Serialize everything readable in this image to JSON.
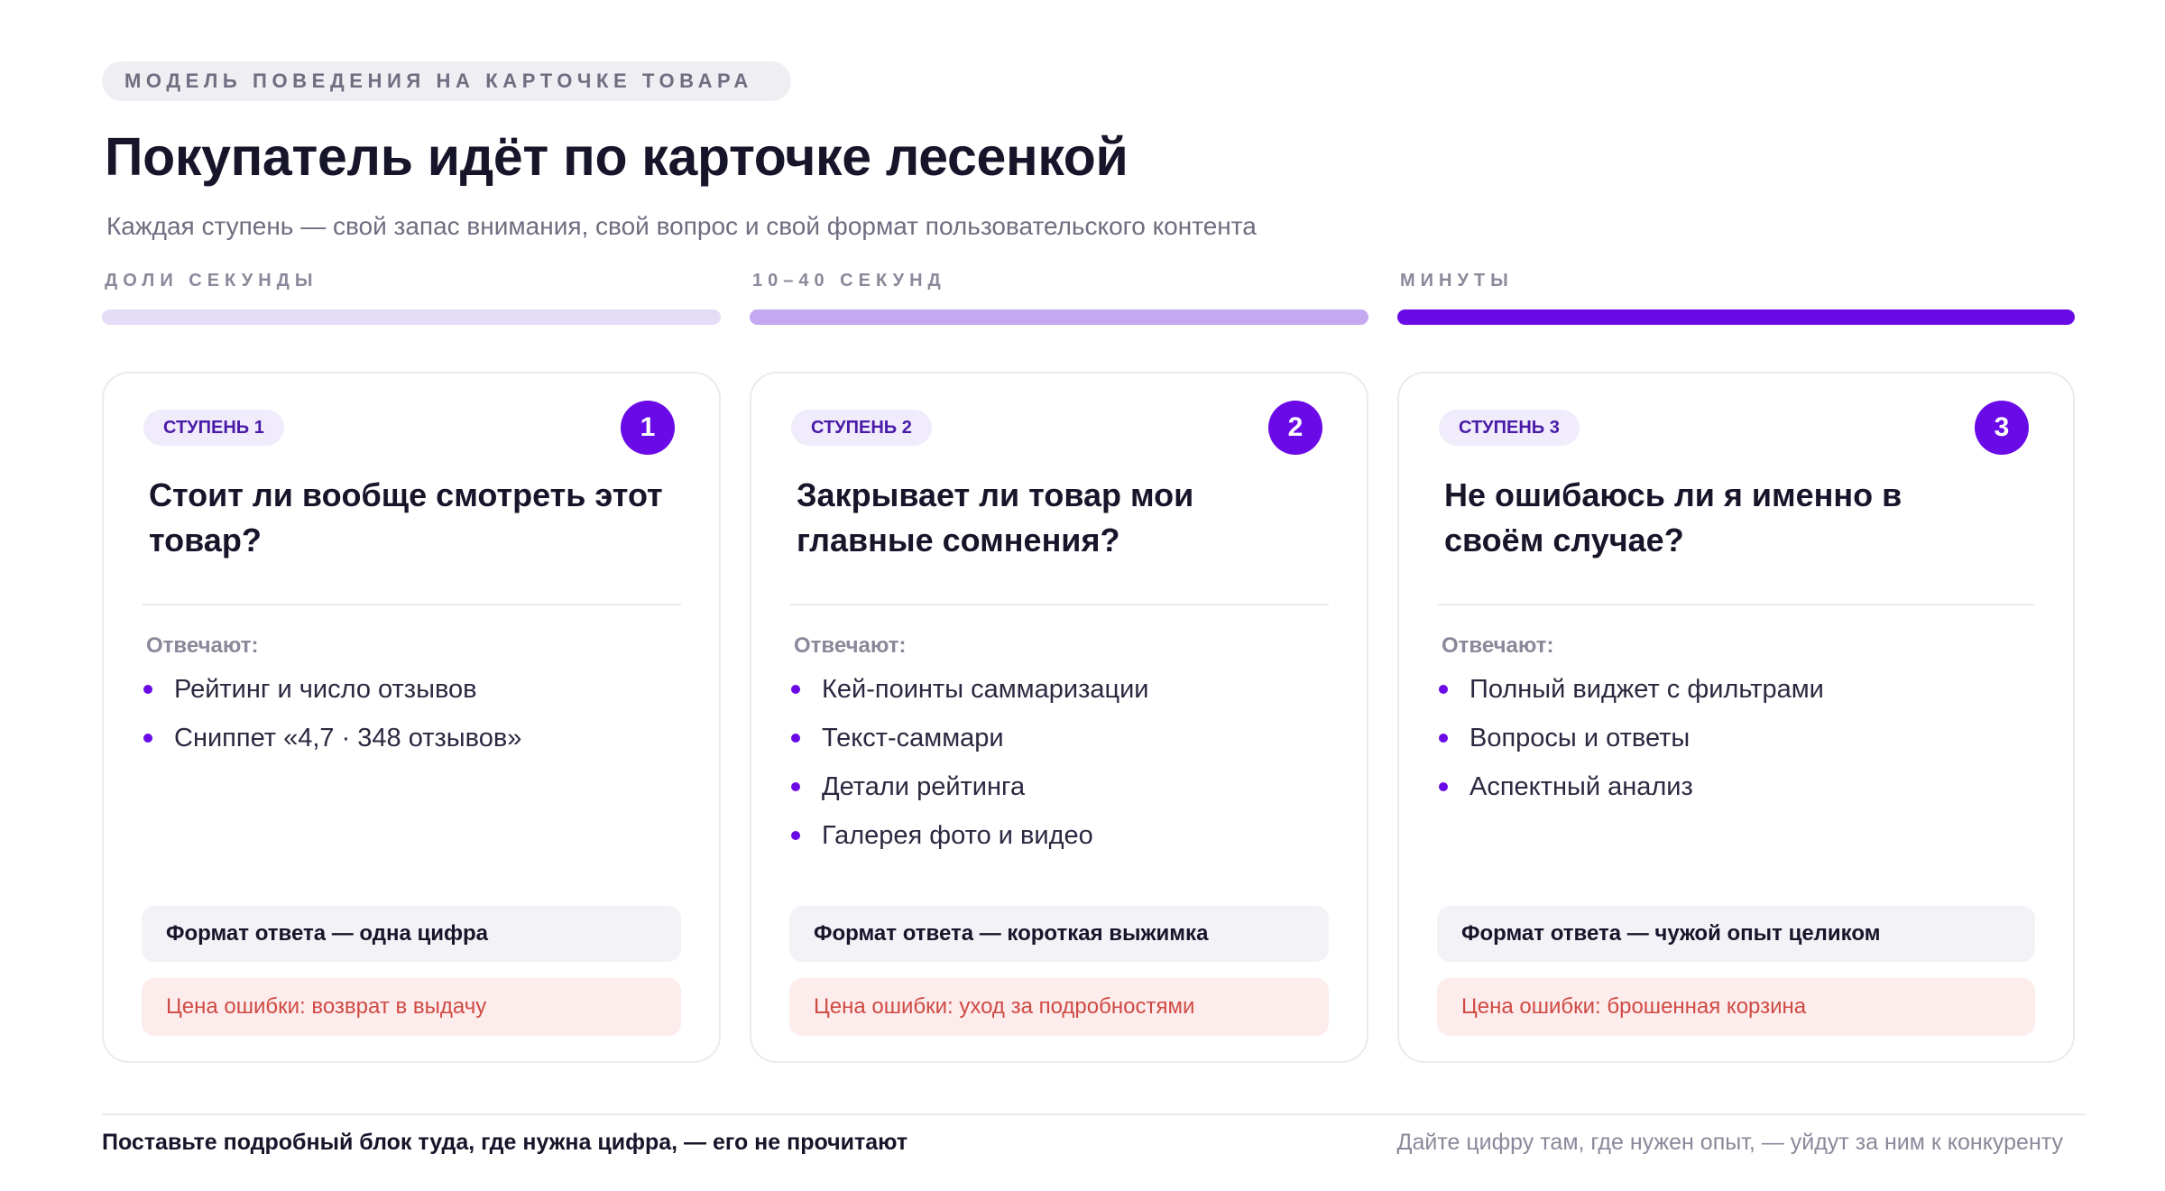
{
  "eyebrow": "МОДЕЛЬ ПОВЕДЕНИЯ НА КАРТОЧКЕ ТОВАРА",
  "title": "Покупатель идёт по карточке лесенкой",
  "subtitle": "Каждая ступень — свой запас внимания, свой вопрос и свой формат пользовательского контента",
  "phases": [
    {
      "label": "ДОЛИ СЕКУНДЫ",
      "color": "#e5dcf8"
    },
    {
      "label": "10–40 СЕКУНД",
      "color": "#c4a8f0"
    },
    {
      "label": "МИНУТЫ",
      "color": "#6a0ae6"
    }
  ],
  "cards": [
    {
      "step_label": "СТУПЕНЬ 1",
      "number": "1",
      "question": "Стоит ли вообще смотреть этот товар?",
      "answers_label": "Отвечают:",
      "bullets": [
        "Рейтинг и число отзывов",
        "Сниппет «4,7 · 348 отзывов»"
      ],
      "format": "Формат ответа — одна цифра",
      "cost": "Цена ошибки: возврат в выдачу"
    },
    {
      "step_label": "СТУПЕНЬ 2",
      "number": "2",
      "question": "Закрывает ли товар мои главные сомнения?",
      "answers_label": "Отвечают:",
      "bullets": [
        "Кей-поинты саммаризации",
        "Текст-саммари",
        "Детали рейтинга",
        "Галерея фото и видео"
      ],
      "format": "Формат ответа — короткая выжимка",
      "cost": "Цена ошибки: уход за подробностями"
    },
    {
      "step_label": "СТУПЕНЬ 3",
      "number": "3",
      "question": "Не ошибаюсь ли я именно в своём случае?",
      "answers_label": "Отвечают:",
      "bullets": [
        "Полный виджет с фильтрами",
        "Вопросы и ответы",
        "Аспектный анализ"
      ],
      "format": "Формат ответа — чужой опыт целиком",
      "cost": "Цена ошибки: брошенная корзина"
    }
  ],
  "footer": {
    "left": "Поставьте подробный блок туда, где нужна цифра, — его не прочитают",
    "right": "Дайте цифру там, где нужен опыт, — уйдут за ним к конкуренту"
  }
}
